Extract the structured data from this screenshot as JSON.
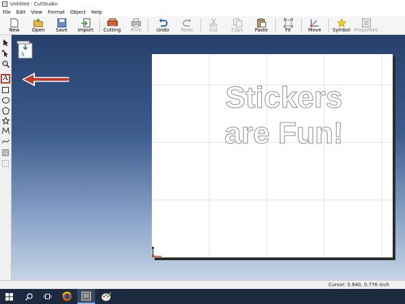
{
  "window": {
    "title": "Untitled - CutStudio"
  },
  "menu": [
    "File",
    "Edit",
    "View",
    "Format",
    "Object",
    "Help"
  ],
  "toolbar": {
    "new": "New",
    "open": "Open",
    "save": "Save",
    "import": "Import",
    "cutting": "Cutting",
    "print": "Print",
    "undo": "Undo",
    "redo": "Redo",
    "cut": "Cut",
    "copy": "Copy",
    "paste": "Paste",
    "fit": "Fit",
    "move": "Move",
    "symbol": "Symbol",
    "properties": "Properties"
  },
  "canvas": {
    "text_line1": "Stickers",
    "text_line2": "are Fun!"
  },
  "status": {
    "cursor": "Cursor: 5.840, 0.776 inch"
  },
  "colors": {
    "highlight": "#c0392b",
    "workspace_top": "#25406c",
    "workspace_bottom": "#c6d4e6"
  }
}
